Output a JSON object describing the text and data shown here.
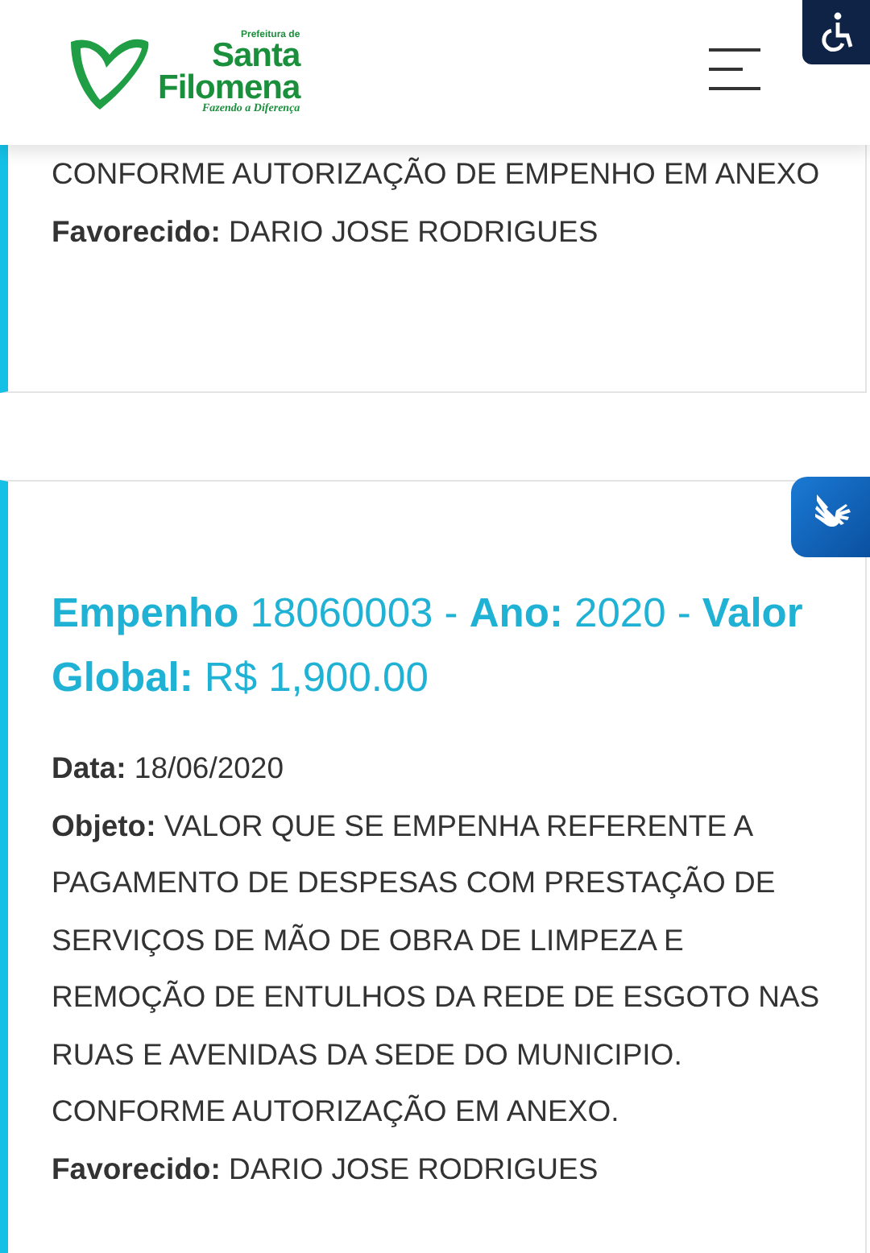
{
  "header": {
    "logo": {
      "top": "Prefeitura de",
      "name_1": "Santa",
      "name_2": "Filomena",
      "slogan": "Fazendo a Diferença"
    }
  },
  "cards": [
    {
      "fields": [
        "CONFORME AUTORIZAÇÃO DE EMPENHO EM ANEXO",
        "**Favorecido:** DARIO JOSE RODRIGUES"
      ]
    },
    {
      "title": "**Empenho** 18060003 - **Ano:** 2020 - **Valor Global:** R$ 1,900.00",
      "fields": [
        "**Data:** 18/06/2020",
        "**Objeto:** VALOR QUE SE EMPENHA REFERENTE A PAGAMENTO DE DESPESAS COM PRESTAÇÃO DE SERVIÇOS DE MÃO DE OBRA DE LIMPEZA E REMOÇÃO DE ENTULHOS DA REDE DE ESGOTO NAS RUAS E AVENIDAS DA SEDE DO MUNICIPIO. CONFORME AUTORIZAÇÃO EM ANEXO.",
        "**Favorecido:** DARIO JOSE RODRIGUES"
      ]
    }
  ]
}
